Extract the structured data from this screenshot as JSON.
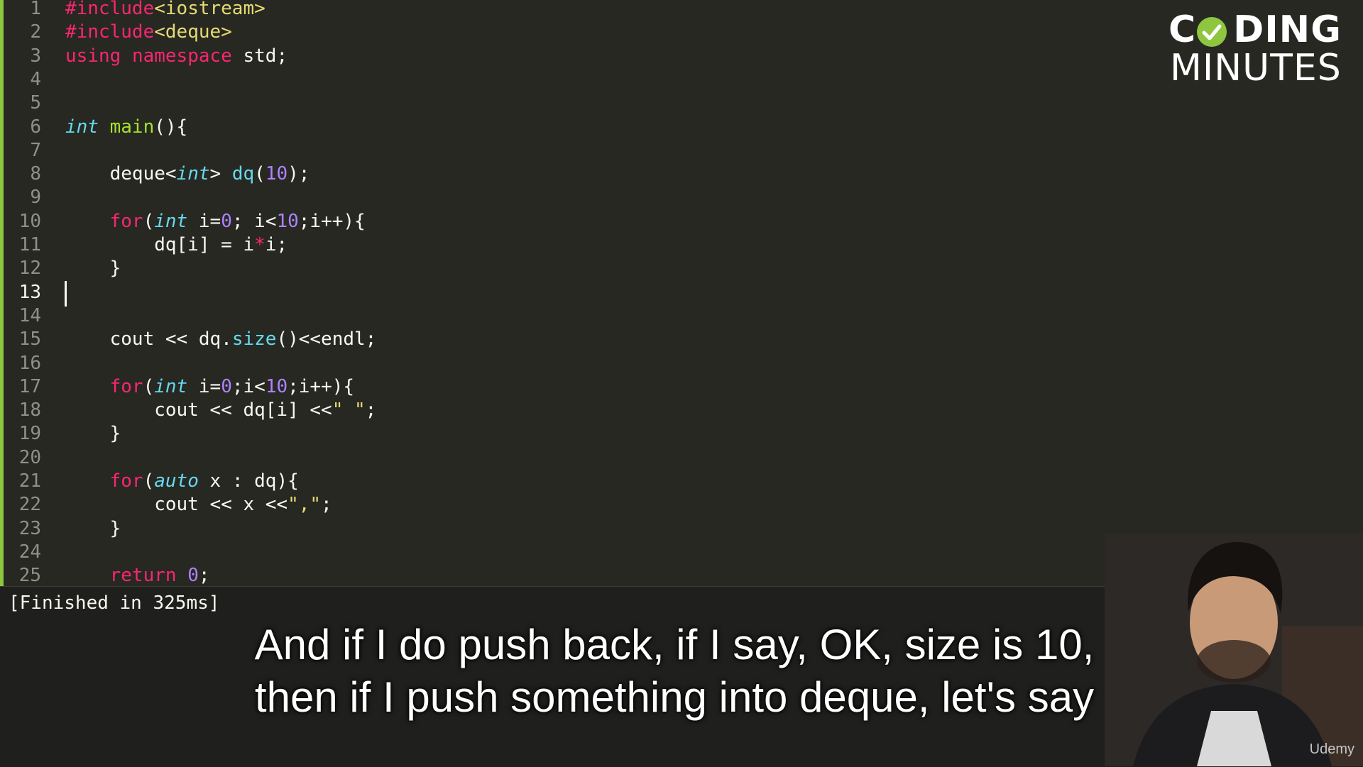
{
  "editor": {
    "lines": [
      {
        "n": "1",
        "tokens": [
          {
            "t": "#include",
            "c": "kw"
          },
          {
            "t": "<iostream>",
            "c": "str"
          }
        ]
      },
      {
        "n": "2",
        "tokens": [
          {
            "t": "#include",
            "c": "kw"
          },
          {
            "t": "<deque>",
            "c": "str"
          }
        ]
      },
      {
        "n": "3",
        "tokens": [
          {
            "t": "using",
            "c": "kw"
          },
          {
            "t": " ",
            "c": "plain"
          },
          {
            "t": "namespace",
            "c": "kw"
          },
          {
            "t": " std;",
            "c": "plain"
          }
        ]
      },
      {
        "n": "4",
        "tokens": []
      },
      {
        "n": "5",
        "tokens": []
      },
      {
        "n": "6",
        "tokens": [
          {
            "t": "int",
            "c": "type"
          },
          {
            "t": " ",
            "c": "plain"
          },
          {
            "t": "main",
            "c": "fn"
          },
          {
            "t": "(){",
            "c": "plain"
          }
        ]
      },
      {
        "n": "7",
        "tokens": []
      },
      {
        "n": "8",
        "tokens": [
          {
            "t": "    deque<",
            "c": "plain"
          },
          {
            "t": "int",
            "c": "type"
          },
          {
            "t": "> ",
            "c": "plain"
          },
          {
            "t": "dq",
            "c": "call"
          },
          {
            "t": "(",
            "c": "plain"
          },
          {
            "t": "10",
            "c": "num"
          },
          {
            "t": ");",
            "c": "plain"
          }
        ]
      },
      {
        "n": "9",
        "tokens": []
      },
      {
        "n": "10",
        "tokens": [
          {
            "t": "    ",
            "c": "plain"
          },
          {
            "t": "for",
            "c": "kw"
          },
          {
            "t": "(",
            "c": "plain"
          },
          {
            "t": "int",
            "c": "type"
          },
          {
            "t": " i=",
            "c": "plain"
          },
          {
            "t": "0",
            "c": "num"
          },
          {
            "t": "; i<",
            "c": "plain"
          },
          {
            "t": "10",
            "c": "num"
          },
          {
            "t": ";i++){",
            "c": "plain"
          }
        ]
      },
      {
        "n": "11",
        "tokens": [
          {
            "t": "        dq[i] = i",
            "c": "plain"
          },
          {
            "t": "*",
            "c": "kw"
          },
          {
            "t": "i;",
            "c": "plain"
          }
        ]
      },
      {
        "n": "12",
        "tokens": [
          {
            "t": "    }",
            "c": "plain"
          }
        ]
      },
      {
        "n": "13",
        "tokens": [],
        "current": true
      },
      {
        "n": "14",
        "tokens": []
      },
      {
        "n": "15",
        "tokens": [
          {
            "t": "    cout << dq.",
            "c": "plain"
          },
          {
            "t": "size",
            "c": "call"
          },
          {
            "t": "()<<endl;",
            "c": "plain"
          }
        ]
      },
      {
        "n": "16",
        "tokens": []
      },
      {
        "n": "17",
        "tokens": [
          {
            "t": "    ",
            "c": "plain"
          },
          {
            "t": "for",
            "c": "kw"
          },
          {
            "t": "(",
            "c": "plain"
          },
          {
            "t": "int",
            "c": "type"
          },
          {
            "t": " i=",
            "c": "plain"
          },
          {
            "t": "0",
            "c": "num"
          },
          {
            "t": ";i<",
            "c": "plain"
          },
          {
            "t": "10",
            "c": "num"
          },
          {
            "t": ";i++){",
            "c": "plain"
          }
        ]
      },
      {
        "n": "18",
        "tokens": [
          {
            "t": "        cout << dq[i] <<",
            "c": "plain"
          },
          {
            "t": "\" \"",
            "c": "str"
          },
          {
            "t": ";",
            "c": "plain"
          }
        ]
      },
      {
        "n": "19",
        "tokens": [
          {
            "t": "    }",
            "c": "plain"
          }
        ]
      },
      {
        "n": "20",
        "tokens": []
      },
      {
        "n": "21",
        "tokens": [
          {
            "t": "    ",
            "c": "plain"
          },
          {
            "t": "for",
            "c": "kw"
          },
          {
            "t": "(",
            "c": "plain"
          },
          {
            "t": "auto",
            "c": "type"
          },
          {
            "t": " x : dq){",
            "c": "plain"
          }
        ]
      },
      {
        "n": "22",
        "tokens": [
          {
            "t": "        cout << x <<",
            "c": "plain"
          },
          {
            "t": "\",\"",
            "c": "str"
          },
          {
            "t": ";",
            "c": "plain"
          }
        ]
      },
      {
        "n": "23",
        "tokens": [
          {
            "t": "    }",
            "c": "plain"
          }
        ]
      },
      {
        "n": "24",
        "tokens": []
      },
      {
        "n": "25",
        "tokens": [
          {
            "t": "    ",
            "c": "plain"
          },
          {
            "t": "return",
            "c": "kw"
          },
          {
            "t": " ",
            "c": "plain"
          },
          {
            "t": "0",
            "c": "num"
          },
          {
            "t": ";",
            "c": "plain"
          }
        ]
      }
    ]
  },
  "logo": {
    "line1": "CODING",
    "line2": "MINUTES"
  },
  "console": {
    "output": "[Finished in 325ms]"
  },
  "caption": {
    "line1": "And if I do push back, if I say, OK, size is 10,",
    "line2": "then if I push something into deque, let's say"
  },
  "watermark": {
    "text": "Udemy"
  },
  "colors": {
    "background": "#272822",
    "keyword": "#f92672",
    "type": "#66d9ef",
    "function": "#a6e22e",
    "number": "#ae81ff",
    "string": "#e6db74",
    "accent": "#8ec63f"
  }
}
